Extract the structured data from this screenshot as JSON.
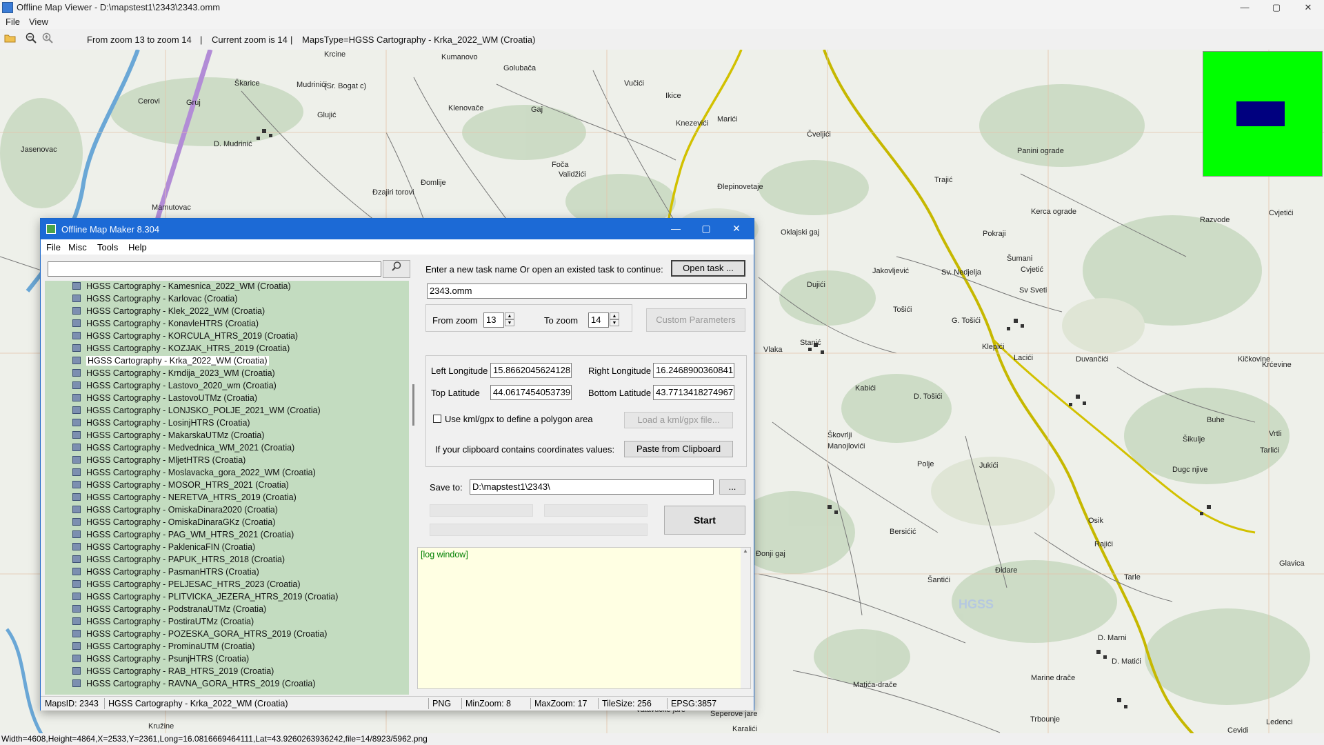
{
  "app": {
    "title": "Offline Map Viewer - D:\\mapstest1\\2343\\2343.omm",
    "menu": [
      "File",
      "View"
    ],
    "window_buttons": [
      "—",
      "▢",
      "✕"
    ]
  },
  "toolbar": {
    "zoom_range": "From zoom 13 to zoom 14",
    "current_zoom": "Current zoom is 14",
    "maps_type": "MapsType=HGSS Cartography - Krka_2022_WM (Croatia)",
    "separator": "|",
    "icons": [
      "folder-open-icon",
      "zoom-out-icon",
      "zoom-in-icon"
    ]
  },
  "map": {
    "place_labels": [
      "Krcine",
      "Kumanovo",
      "Golubača",
      "Škarice",
      "Mudrinići",
      "(Sr. Bogat c)",
      "Cerovi",
      "Gruj",
      "Glujić",
      "Jasenovac",
      "D. Mudrinić",
      "Klenovače",
      "Gaj",
      "Vučići",
      "Ikice",
      "Knezevići",
      "Marići",
      "Foča",
      "Validžići",
      "Đomlije",
      "Đzajiri torovi",
      "Mamutovac",
      "Đlepinovetaje",
      "Oklajski gaj",
      "Čveljići",
      "Trajić",
      "Panini ograde",
      "Kerca ograde",
      "Razvode",
      "Cvjetići",
      "Pokraji",
      "Šumani",
      "Cvjetić",
      "Jakovljević",
      "Dujići",
      "Sv. Nedjelja",
      "Sv Sveti",
      "Tošići",
      "G. Tošići",
      "Vlaka",
      "Stanić",
      "Klepići",
      "Lacići",
      "Duvančići",
      "Kičkovine",
      "Krćevine",
      "Kabići",
      "D. Tošići",
      "Buhe",
      "Vrtli",
      "Škovrlji",
      "Manojlovići",
      "Polje",
      "Jukići",
      "Šikulje",
      "Tarlići",
      "Dugc njive",
      "Osik",
      "Bersićić",
      "Đonji gaj",
      "Rajići",
      "Tarle",
      "Šantići",
      "Đidare",
      "D. Marni",
      "D. Matići",
      "Marine drače",
      "Matića-drače",
      "Vatavucke jare",
      "Seperove jare",
      "Trbounje",
      "Ledenci",
      "Karalići",
      "Kružine",
      "Cevidi",
      "Glavica",
      "HGSS"
    ]
  },
  "minimap": {
    "bg_color": "#00ff00",
    "view_color": "#00007f"
  },
  "status_line": "Width=4608,Height=4864,X=2533,Y=2361,Long=16.0816669464111,Lat=43.9260263936242,file=14/8923/5962.png",
  "dialog": {
    "title": "Offline Map Maker 8.304",
    "menu": [
      "File",
      "Misc",
      "Tools",
      "Help"
    ],
    "search": {
      "value": "",
      "button_icon": "search-icon"
    },
    "tree_items": [
      "HGSS Cartography - Kamesnica_2022_WM (Croatia)",
      "HGSS Cartography - Karlovac (Croatia)",
      "HGSS Cartography - Klek_2022_WM (Croatia)",
      "HGSS Cartography - KonavleHTRS (Croatia)",
      "HGSS Cartography - KORCULA_HTRS_2019 (Croatia)",
      "HGSS Cartography - KOZJAK_HTRS_2019 (Croatia)",
      "HGSS Cartography - Krka_2022_WM (Croatia)",
      "HGSS Cartography - Krndija_2023_WM (Croatia)",
      "HGSS Cartography - Lastovo_2020_wm (Croatia)",
      "HGSS Cartography - LastovoUTMz (Croatia)",
      "HGSS Cartography - LONJSKO_POLJE_2021_WM (Croatia)",
      "HGSS Cartography - LosinjHTRS (Croatia)",
      "HGSS Cartography - MakarskaUTMz (Croatia)",
      "HGSS Cartography - Medvednica_WM_2021 (Croatia)",
      "HGSS Cartography - MljetHTRS (Croatia)",
      "HGSS Cartography - Moslavacka_gora_2022_WM (Croatia)",
      "HGSS Cartography - MOSOR_HTRS_2021 (Croatia)",
      "HGSS Cartography - NERETVA_HTRS_2019 (Croatia)",
      "HGSS Cartography - OmiskaDinara2020 (Croatia)",
      "HGSS Cartography - OmiskaDinaraGKz (Croatia)",
      "HGSS Cartography - PAG_WM_HTRS_2021 (Croatia)",
      "HGSS Cartography - PaklenicaFIN (Croatia)",
      "HGSS Cartography - PAPUK_HTRS_2018 (Croatia)",
      "HGSS Cartography - PasmanHTRS (Croatia)",
      "HGSS Cartography - PELJESAC_HTRS_2023 (Croatia)",
      "HGSS Cartography - PLITVICKA_JEZERA_HTRS_2019 (Croatia)",
      "HGSS Cartography - PodstranaUTMz (Croatia)",
      "HGSS Cartography - PostiraUTMz (Croatia)",
      "HGSS Cartography - POZESKA_GORA_HTRS_2019 (Croatia)",
      "HGSS Cartography - ProminaUTM (Croatia)",
      "HGSS Cartography - PsunjHTRS (Croatia)",
      "HGSS Cartography - RAB_HTRS_2019 (Croatia)",
      "HGSS Cartography - RAVNA_GORA_HTRS_2019 (Croatia)"
    ],
    "selected_item": "HGSS Cartography - Krka_2022_WM (Croatia)",
    "task_prompt": "Enter a new task name Or open an existed task to continue:",
    "open_task_label": "Open task ...",
    "task_name": "2343.omm",
    "from_zoom_label": "From zoom",
    "from_zoom": "13",
    "to_zoom_label": "To zoom",
    "to_zoom": "14",
    "custom_params_label": "Custom Parameters",
    "left_lon_label": "Left Longitude",
    "left_lon": "15.8662045624128",
    "right_lon_label": "Right Longitude",
    "right_lon": "16.2468900360841",
    "top_lat_label": "Top Latitude",
    "top_lat": "44.0617454053739",
    "bottom_lat_label": "Bottom Latitude",
    "bottom_lat": "43.7713418274967",
    "kml_label": "Use kml/gpx to define a polygon area",
    "load_kml_label": "Load a kml/gpx file...",
    "clipboard_prompt": "If your clipboard contains coordinates values:",
    "paste_label": "Paste from Clipboard",
    "save_to_label": "Save to:",
    "save_path": "D:\\mapstest1\\2343\\",
    "browse_label": "...",
    "start_label": "Start",
    "log_text": "[log window]",
    "status": {
      "maps_id": "MapsID: 2343",
      "maps_name": "HGSS Cartography - Krka_2022_WM (Croatia)",
      "format": "PNG",
      "min_zoom": "MinZoom: 8",
      "max_zoom": "MaxZoom: 17",
      "tile_size": "TileSize: 256",
      "epsg": "EPSG:3857"
    }
  }
}
